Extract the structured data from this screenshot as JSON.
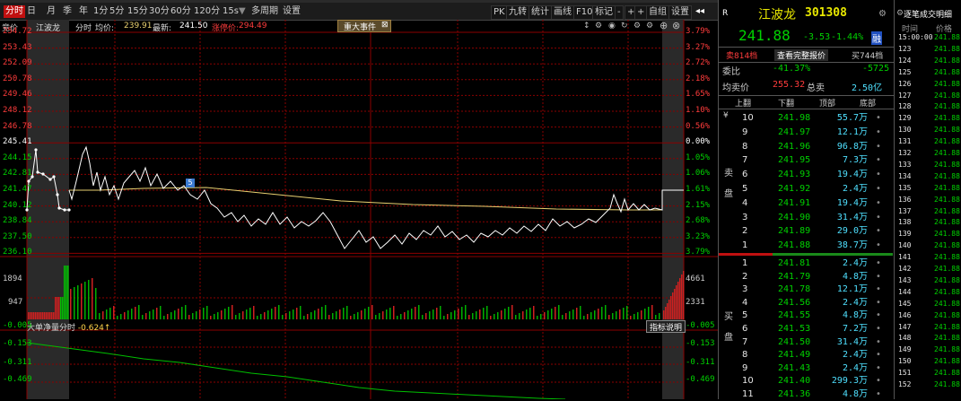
{
  "toolbar": {
    "tabs": [
      "分时",
      "日",
      "月",
      "季",
      "年",
      "1分",
      "5分",
      "15分",
      "30分",
      "60分",
      "120分",
      "15s",
      "多周期",
      "设置"
    ],
    "active_tab": "分时",
    "right_buttons": [
      "PK",
      "九转",
      "统计",
      "画线",
      "F10",
      "标记",
      "-",
      "+",
      "+",
      "自组",
      "设置"
    ],
    "icons": [
      "back-arrow-icon",
      "triangle-icon"
    ]
  },
  "chart": {
    "legend_labels": {
      "auction": "竞价",
      "name": "江波龙",
      "minute_label": "分时",
      "avg_label": "均价:",
      "avg_value": "239.91",
      "last_label": "最新:",
      "last_value": "241.50",
      "limit_label": "涨停价:",
      "limit_value": "294.49"
    },
    "event_button": "重大事件",
    "event_close": "⊠",
    "event_marker": "5",
    "icons": [
      "up-down-icon",
      "gear-icon",
      "eye-icon",
      "refresh-icon",
      "settings-icon",
      "settings-icon",
      "add-icon"
    ],
    "price_left": [
      "254.72",
      "253.43",
      "252.09",
      "250.78",
      "249.46",
      "248.12",
      "246.78",
      "245.41",
      "244.15",
      "242.81",
      "241.47",
      "240.12",
      "238.84",
      "237.50",
      "236.10"
    ],
    "price_right": [
      "3.79%",
      "3.27%",
      "2.72%",
      "2.18%",
      "1.65%",
      "1.10%",
      "0.56%",
      "0.00%",
      "1.05%",
      "1.06%",
      "1.61%",
      "2.15%",
      "2.68%",
      "3.23%",
      "3.79%"
    ],
    "vol_left": [
      "1894",
      "947"
    ],
    "vol_right": [
      "4661",
      "2331"
    ],
    "indicator_title": "大单净量分时",
    "indicator_value": "-0.624↑",
    "indicator_help": "指标说明",
    "ind_left": [
      "-0.005",
      "-0.153",
      "-0.311",
      "-0.469"
    ],
    "ind_right": [
      "-0.005",
      "-0.153",
      "-0.311",
      "-0.469"
    ],
    "colors": {
      "grid": "#8b0000",
      "price_line": "#ffffff",
      "avg_line": "#e8d070",
      "ind_line": "#00c000"
    }
  },
  "info": {
    "header": "R",
    "name": "江波龙",
    "code": "301308",
    "price": "241.88",
    "change": "-3.53",
    "pct": "-1.44%",
    "badge": "融",
    "btn_sell": "卖814档",
    "btn_view": "查看完整报价",
    "btn_buy": "买744档",
    "wb_label": "委比",
    "wb_value": "-41.37%",
    "wb_diff": "-5725",
    "avg_sell_label": "均卖价",
    "avg_sell_value": "255.32",
    "total_sell_label": "总卖",
    "total_sell_value": "2.50亿",
    "col_headers": [
      "上翻",
      "下翻",
      "顶部",
      "底部"
    ],
    "sell_side_label": [
      "卖",
      "盘"
    ],
    "buy_side_label": [
      "买",
      "盘"
    ],
    "yen": "¥",
    "sells": [
      {
        "lvl": "10",
        "price": "241.98",
        "vol": "55.7万"
      },
      {
        "lvl": "9",
        "price": "241.97",
        "vol": "12.1万"
      },
      {
        "lvl": "8",
        "price": "241.96",
        "vol": "96.8万"
      },
      {
        "lvl": "7",
        "price": "241.95",
        "vol": "7.3万"
      },
      {
        "lvl": "6",
        "price": "241.93",
        "vol": "19.4万"
      },
      {
        "lvl": "5",
        "price": "241.92",
        "vol": "2.4万"
      },
      {
        "lvl": "4",
        "price": "241.91",
        "vol": "19.4万"
      },
      {
        "lvl": "3",
        "price": "241.90",
        "vol": "31.4万"
      },
      {
        "lvl": "2",
        "price": "241.89",
        "vol": "29.0万"
      },
      {
        "lvl": "1",
        "price": "241.88",
        "vol": "38.7万"
      }
    ],
    "buys": [
      {
        "lvl": "1",
        "price": "241.81",
        "vol": "2.4万"
      },
      {
        "lvl": "2",
        "price": "241.79",
        "vol": "4.8万"
      },
      {
        "lvl": "3",
        "price": "241.78",
        "vol": "12.1万"
      },
      {
        "lvl": "4",
        "price": "241.56",
        "vol": "2.4万"
      },
      {
        "lvl": "5",
        "price": "241.55",
        "vol": "4.8万"
      },
      {
        "lvl": "6",
        "price": "241.53",
        "vol": "7.2万"
      },
      {
        "lvl": "7",
        "price": "241.50",
        "vol": "31.4万"
      },
      {
        "lvl": "8",
        "price": "241.49",
        "vol": "2.4万"
      },
      {
        "lvl": "9",
        "price": "241.43",
        "vol": "2.4万"
      },
      {
        "lvl": "10",
        "price": "241.40",
        "vol": "299.3万"
      },
      {
        "lvl": "11",
        "price": "241.36",
        "vol": "4.8万"
      }
    ]
  },
  "trades": {
    "title": "逐笔成交明细",
    "col_time": "时间",
    "col_price": "价格",
    "rows": [
      {
        "t": "15:00:00",
        "p": "241.88"
      },
      {
        "t": "123",
        "p": "241.88"
      },
      {
        "t": "124",
        "p": "241.88"
      },
      {
        "t": "125",
        "p": "241.88"
      },
      {
        "t": "126",
        "p": "241.88"
      },
      {
        "t": "127",
        "p": "241.88"
      },
      {
        "t": "128",
        "p": "241.88"
      },
      {
        "t": "129",
        "p": "241.88"
      },
      {
        "t": "130",
        "p": "241.88"
      },
      {
        "t": "131",
        "p": "241.88"
      },
      {
        "t": "132",
        "p": "241.88"
      },
      {
        "t": "133",
        "p": "241.88"
      },
      {
        "t": "134",
        "p": "241.88"
      },
      {
        "t": "135",
        "p": "241.88"
      },
      {
        "t": "136",
        "p": "241.88"
      },
      {
        "t": "137",
        "p": "241.88"
      },
      {
        "t": "138",
        "p": "241.88"
      },
      {
        "t": "139",
        "p": "241.88"
      },
      {
        "t": "140",
        "p": "241.88"
      },
      {
        "t": "141",
        "p": "241.88"
      },
      {
        "t": "142",
        "p": "241.88"
      },
      {
        "t": "143",
        "p": "241.88"
      },
      {
        "t": "144",
        "p": "241.88"
      },
      {
        "t": "145",
        "p": "241.88"
      },
      {
        "t": "146",
        "p": "241.88"
      },
      {
        "t": "147",
        "p": "241.88"
      },
      {
        "t": "148",
        "p": "241.88"
      },
      {
        "t": "149",
        "p": "241.88"
      },
      {
        "t": "150",
        "p": "241.88"
      },
      {
        "t": "151",
        "p": "241.88"
      },
      {
        "t": "152",
        "p": "241.88"
      }
    ]
  }
}
